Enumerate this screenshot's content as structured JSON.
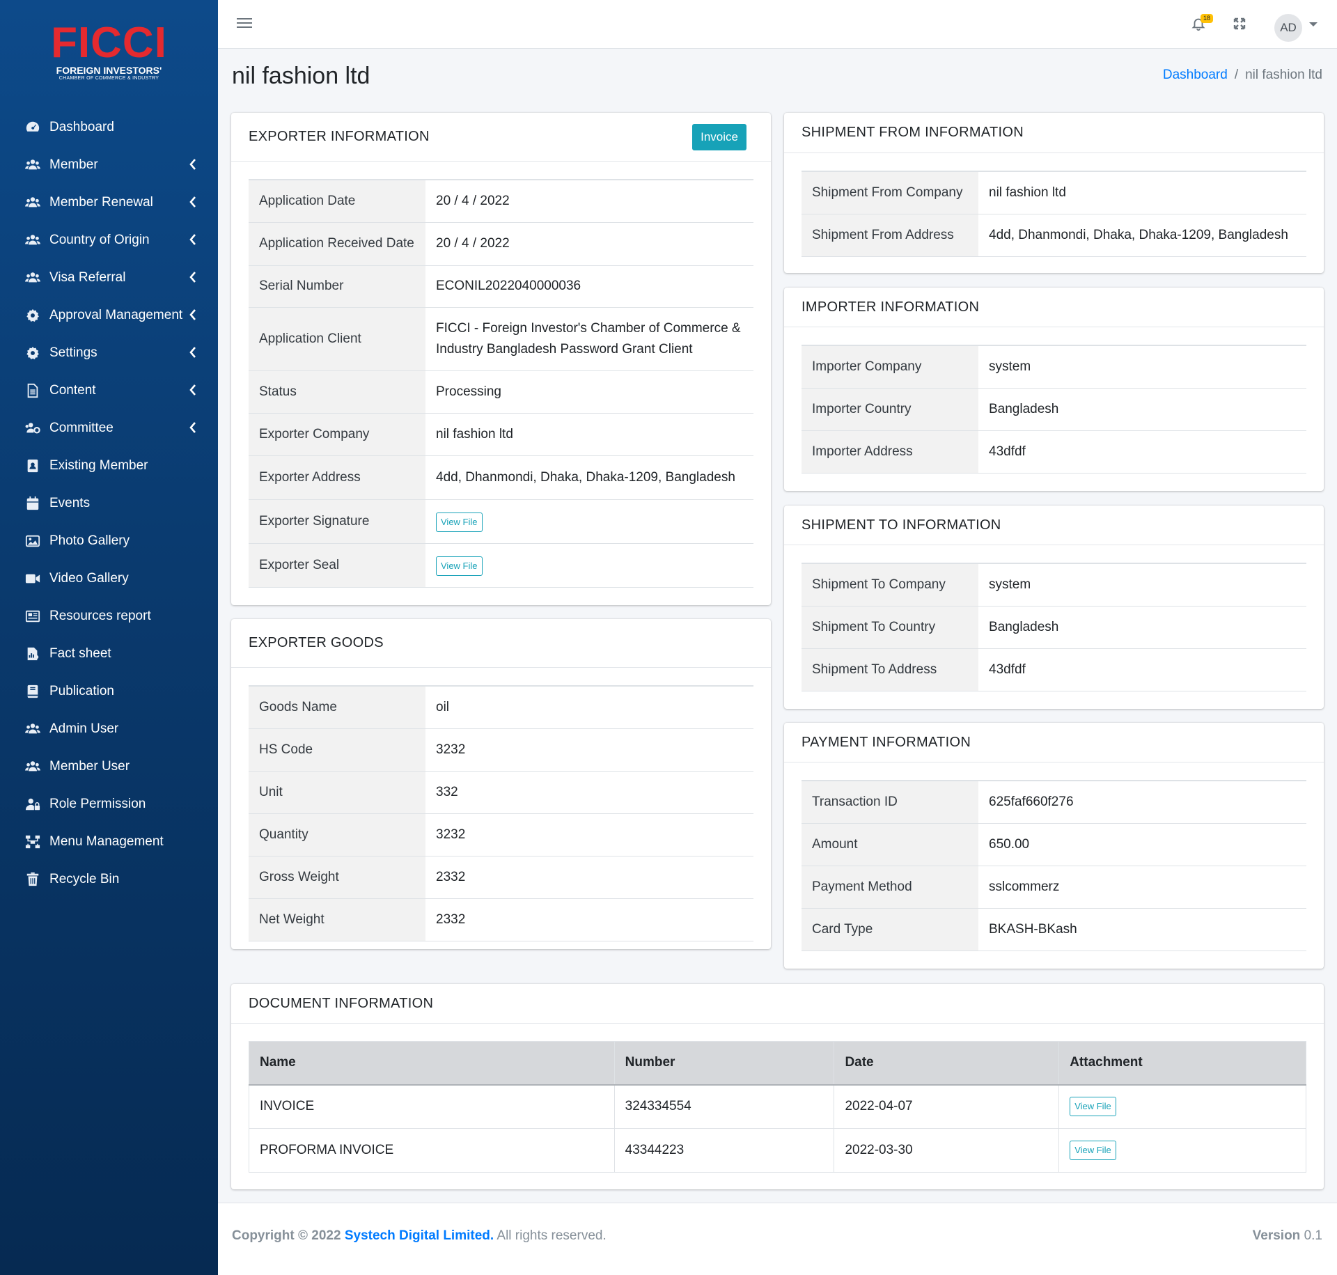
{
  "logo": {
    "main": "FICCI",
    "sub": "FOREIGN INVESTORS'",
    "sub2": "CHAMBER OF COMMERCE & INDUSTRY"
  },
  "sidebar": {
    "items": [
      {
        "label": "Dashboard",
        "icon": "dashboard-icon",
        "caret": false
      },
      {
        "label": "Member",
        "icon": "users-icon",
        "caret": true
      },
      {
        "label": "Member Renewal",
        "icon": "users-icon",
        "caret": true
      },
      {
        "label": "Country of Origin",
        "icon": "users-icon",
        "caret": true
      },
      {
        "label": "Visa Referral",
        "icon": "users-icon",
        "caret": true
      },
      {
        "label": "Approval Management",
        "icon": "gear-icon",
        "caret": true
      },
      {
        "label": "Settings",
        "icon": "gear-icon",
        "caret": true
      },
      {
        "label": "Content",
        "icon": "file-icon",
        "caret": true
      },
      {
        "label": "Committee",
        "icon": "users-cog-icon",
        "caret": true
      },
      {
        "label": "Existing Member",
        "icon": "address-book-icon",
        "caret": false
      },
      {
        "label": "Events",
        "icon": "calendar-icon",
        "caret": false
      },
      {
        "label": "Photo Gallery",
        "icon": "image-icon",
        "caret": false
      },
      {
        "label": "Video Gallery",
        "icon": "video-icon",
        "caret": false
      },
      {
        "label": "Resources report",
        "icon": "newspaper-icon",
        "caret": false
      },
      {
        "label": "Fact sheet",
        "icon": "file-chart-icon",
        "caret": false
      },
      {
        "label": "Publication",
        "icon": "book-icon",
        "caret": false
      },
      {
        "label": "Admin User",
        "icon": "users-icon",
        "caret": false
      },
      {
        "label": "Member User",
        "icon": "users-icon",
        "caret": false
      },
      {
        "label": "Role Permission",
        "icon": "user-lock-icon",
        "caret": false
      },
      {
        "label": "Menu Management",
        "icon": "sitemap-icon",
        "caret": false
      },
      {
        "label": "Recycle Bin",
        "icon": "trash-icon",
        "caret": false
      }
    ]
  },
  "header": {
    "notification_count": "18",
    "avatar_initials": "AD"
  },
  "page": {
    "title": "nil fashion ltd"
  },
  "breadcrumb": {
    "home": "Dashboard",
    "current": "nil fashion ltd",
    "separator": "/"
  },
  "exporter": {
    "title": "EXPORTER INFORMATION",
    "invoice_button": "Invoice",
    "rows": [
      {
        "k": "Application Date",
        "v": "20 / 4 / 2022"
      },
      {
        "k": "Application Received Date",
        "v": "20 / 4 / 2022"
      },
      {
        "k": "Serial Number",
        "v": "ECONIL2022040000036"
      },
      {
        "k": "Application Client",
        "v": "FICCI - Foreign Investor's Chamber of Commerce & Industry Bangladesh Password Grant Client"
      },
      {
        "k": "Status",
        "v": "Processing"
      },
      {
        "k": "Exporter Company",
        "v": "nil fashion ltd"
      },
      {
        "k": "Exporter Address",
        "v": "4dd, Dhanmondi, Dhaka, Dhaka-1209, Bangladesh"
      },
      {
        "k": "Exporter Signature",
        "v": "View File"
      },
      {
        "k": "Exporter Seal",
        "v": "View File"
      }
    ]
  },
  "goods": {
    "title": "EXPORTER GOODS",
    "rows": [
      {
        "k": "Goods Name",
        "v": "oil"
      },
      {
        "k": "HS Code",
        "v": "3232"
      },
      {
        "k": "Unit",
        "v": "332"
      },
      {
        "k": "Quantity",
        "v": "3232"
      },
      {
        "k": "Gross Weight",
        "v": "2332"
      },
      {
        "k": "Net Weight",
        "v": "2332"
      }
    ]
  },
  "shipment_from": {
    "title": "SHIPMENT FROM INFORMATION",
    "rows": [
      {
        "k": "Shipment From Company",
        "v": "nil fashion ltd"
      },
      {
        "k": "Shipment From Address",
        "v": "4dd, Dhanmondi, Dhaka, Dhaka-1209, Bangladesh"
      }
    ]
  },
  "importer": {
    "title": "IMPORTER INFORMATION",
    "rows": [
      {
        "k": "Importer Company",
        "v": "system"
      },
      {
        "k": "Importer Country",
        "v": "Bangladesh"
      },
      {
        "k": "Importer Address",
        "v": "43dfdf"
      }
    ]
  },
  "shipment_to": {
    "title": "SHIPMENT TO INFORMATION",
    "rows": [
      {
        "k": "Shipment To Company",
        "v": "system"
      },
      {
        "k": "Shipment To Country",
        "v": "Bangladesh"
      },
      {
        "k": "Shipment To Address",
        "v": "43dfdf"
      }
    ]
  },
  "payment": {
    "title": "PAYMENT INFORMATION",
    "rows": [
      {
        "k": "Transaction ID",
        "v": "625faf660f276"
      },
      {
        "k": "Amount",
        "v": "650.00"
      },
      {
        "k": "Payment Method",
        "v": "sslcommerz"
      },
      {
        "k": "Card Type",
        "v": "BKASH-BKash"
      }
    ]
  },
  "documents": {
    "title": "DOCUMENT INFORMATION",
    "columns": [
      "Name",
      "Number",
      "Date",
      "Attachment"
    ],
    "rows": [
      {
        "name": "INVOICE",
        "number": "324334554",
        "date": "2022-04-07",
        "attachment": "View File"
      },
      {
        "name": "PROFORMA INVOICE",
        "number": "43344223",
        "date": "2022-03-30",
        "attachment": "View File"
      }
    ]
  },
  "footer": {
    "copyright": "Copyright © 2022",
    "company": "Systech Digital Limited.",
    "rights": "All rights reserved.",
    "version_label": "Version",
    "version": "0.1"
  },
  "colors": {
    "sidebar": "#0a3a6e",
    "accent": "#17a2b8",
    "link": "#007bff",
    "logo": "#e52a2f"
  }
}
